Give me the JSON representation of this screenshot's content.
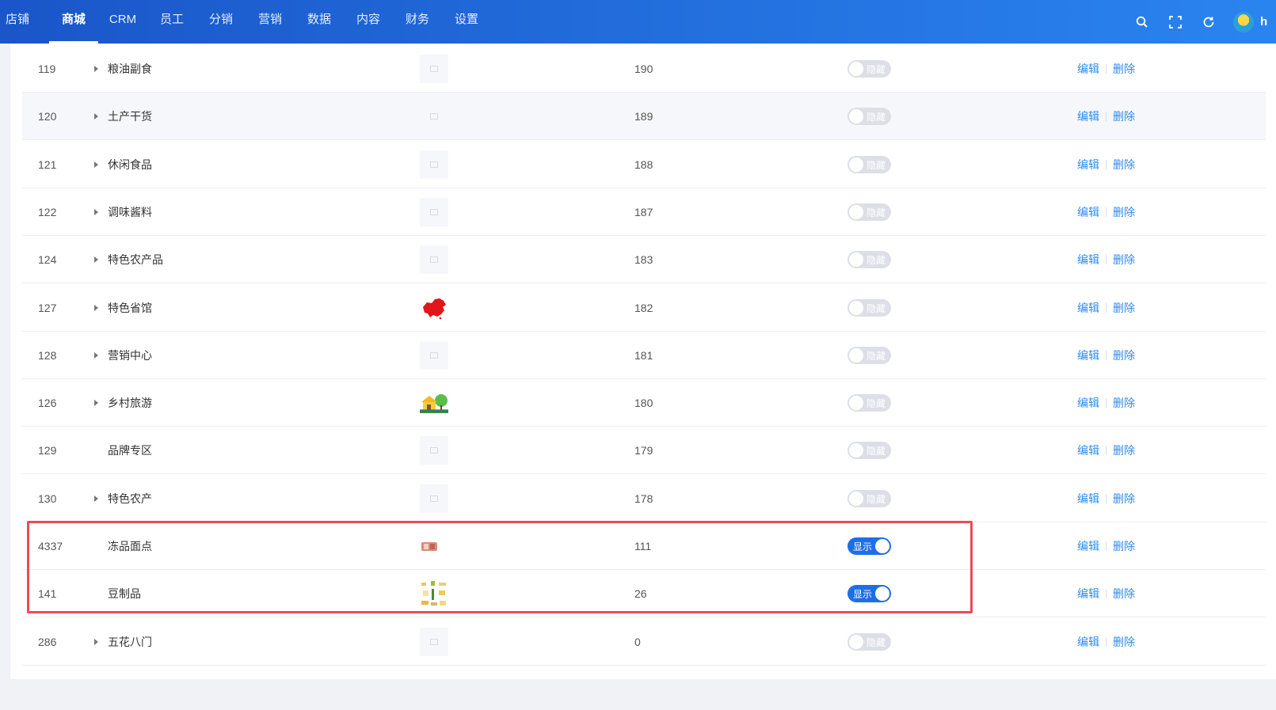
{
  "nav": {
    "items": [
      {
        "label": "店铺",
        "active": false
      },
      {
        "label": "商城",
        "active": true
      },
      {
        "label": "CRM",
        "active": false
      },
      {
        "label": "员工",
        "active": false
      },
      {
        "label": "分销",
        "active": false
      },
      {
        "label": "营销",
        "active": false
      },
      {
        "label": "数据",
        "active": false
      },
      {
        "label": "内容",
        "active": false
      },
      {
        "label": "财务",
        "active": false
      },
      {
        "label": "设置",
        "active": false
      }
    ],
    "user_name": "h",
    "icons": [
      "search-icon",
      "fullscreen-icon",
      "refresh-icon"
    ]
  },
  "table": {
    "ops": {
      "edit": "编辑",
      "delete": "删除"
    },
    "rows": [
      {
        "id": "119",
        "name": "粮油副食",
        "has_children": true,
        "image": "placeholder",
        "sort": "190",
        "status": "隐藏",
        "on": false
      },
      {
        "id": "120",
        "name": "土产干货",
        "has_children": true,
        "image": "placeholder",
        "sort": "189",
        "status": "隐藏",
        "on": false
      },
      {
        "id": "121",
        "name": "休闲食品",
        "has_children": true,
        "image": "placeholder",
        "sort": "188",
        "status": "隐藏",
        "on": false
      },
      {
        "id": "122",
        "name": "调味酱料",
        "has_children": true,
        "image": "placeholder",
        "sort": "187",
        "status": "隐藏",
        "on": false
      },
      {
        "id": "124",
        "name": "特色农产品",
        "has_children": true,
        "image": "placeholder",
        "sort": "183",
        "status": "隐藏",
        "on": false
      },
      {
        "id": "127",
        "name": "特色省馆",
        "has_children": true,
        "image": "china-map",
        "sort": "182",
        "status": "隐藏",
        "on": false
      },
      {
        "id": "128",
        "name": "营销中心",
        "has_children": true,
        "image": "placeholder",
        "sort": "181",
        "status": "隐藏",
        "on": false
      },
      {
        "id": "126",
        "name": "乡村旅游",
        "has_children": true,
        "image": "village-house",
        "sort": "180",
        "status": "隐藏",
        "on": false
      },
      {
        "id": "129",
        "name": "品牌专区",
        "has_children": false,
        "image": "placeholder",
        "sort": "179",
        "status": "隐藏",
        "on": false
      },
      {
        "id": "130",
        "name": "特色农产",
        "has_children": true,
        "image": "placeholder",
        "sort": "178",
        "status": "隐藏",
        "on": false
      },
      {
        "id": "4337",
        "name": "冻品面点",
        "has_children": false,
        "image": "frozen-food",
        "sort": "111",
        "status": "显示",
        "on": true
      },
      {
        "id": "141",
        "name": "豆制品",
        "has_children": false,
        "image": "tofu-products",
        "sort": "26",
        "status": "显示",
        "on": true
      },
      {
        "id": "286",
        "name": "五花八门",
        "has_children": true,
        "image": "placeholder",
        "sort": "0",
        "status": "隐藏",
        "on": false
      }
    ]
  },
  "colors": {
    "accent": "#1e6fe6",
    "link": "#2d8cf0",
    "highlight": "#ea4b56"
  }
}
